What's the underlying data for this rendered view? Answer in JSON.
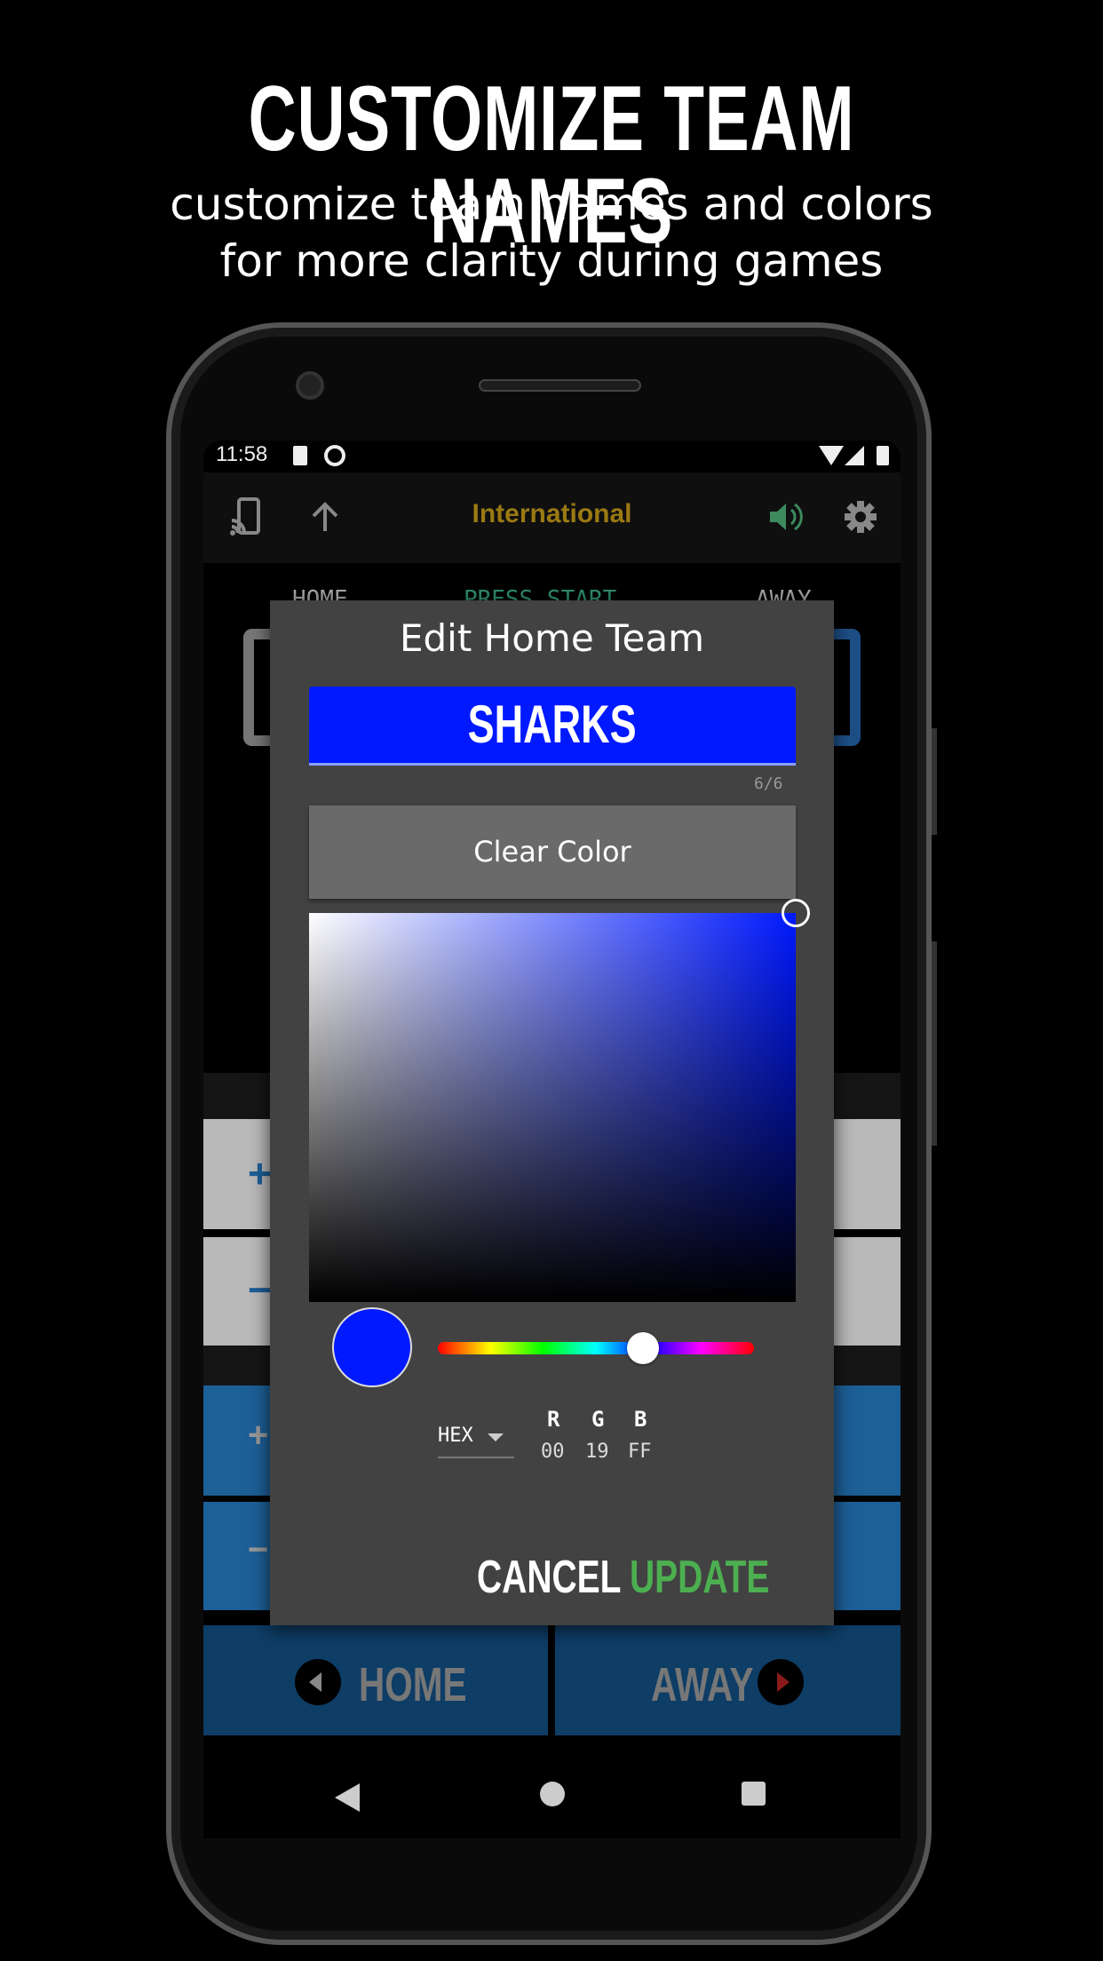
{
  "promo": {
    "headline": "CUSTOMIZE TEAM NAMES",
    "sub_line1": "customize team names and colors",
    "sub_line2": "for more clarity during games"
  },
  "status_bar": {
    "time": "11:58"
  },
  "toolbar": {
    "title": "International",
    "icons": [
      "cast-icon",
      "arrow-up-icon",
      "volume-icon",
      "gear-icon"
    ]
  },
  "scoreboard": {
    "home_label": "HOME",
    "status": "PRESS START",
    "away_label": "AWAY",
    "home_button": "HOME",
    "away_button": "AWAY",
    "plus": "+",
    "minus": "−"
  },
  "dialog": {
    "title": "Edit Home Team",
    "team_name": "SHARKS",
    "char_count": "6/6",
    "clear_color": "Clear Color",
    "color_mode": "HEX",
    "r_label": "R",
    "g_label": "G",
    "b_label": "B",
    "r_value": "00",
    "g_value": "19",
    "b_value": "FF",
    "cancel": "CANCEL",
    "update": "UPDATE",
    "hue_position": 0.65
  },
  "colors": {
    "team_color": "#0019FF",
    "title_accent": "#9a7a12",
    "update_green": "#4caf50",
    "dialog_bg": "#424242"
  }
}
